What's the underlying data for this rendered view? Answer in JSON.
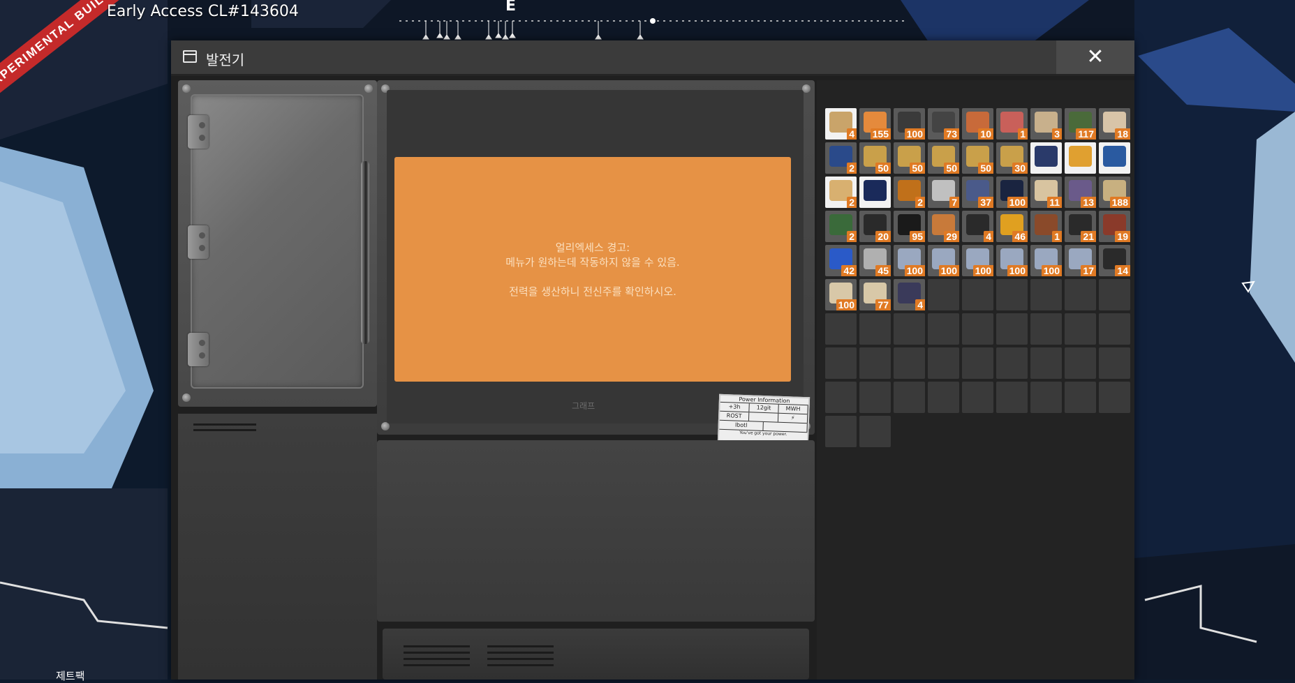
{
  "hud": {
    "build_label": "Early Access CL#143604",
    "banner": "EXPERIMENTAL BUILD",
    "compass_heading": "E",
    "jetpack_label": "제트팩"
  },
  "window": {
    "title": "발전기",
    "close_glyph": "✕"
  },
  "warning": {
    "line1": "얼리엑세스 경고:",
    "line2": "메뉴가 원하는데 작동하지 않을 수 있음.",
    "line3": "전력을 생산하니 전신주를 확인하시오."
  },
  "graph_label": "그래프",
  "power_card": {
    "title": "Power Information",
    "row1": [
      "+3h",
      "12git",
      "MWH"
    ],
    "row2": [
      "ROST",
      "",
      ""
    ],
    "row3": [
      "lbotl",
      "",
      ""
    ],
    "footer": "You've got your power."
  },
  "inventory": {
    "columns": 9,
    "total_slots": 83,
    "items": [
      {
        "qty": "4",
        "icon": "cable-icon",
        "color": "#c9a46a",
        "highlight": true
      },
      {
        "qty": "155",
        "icon": "ingot-icon",
        "color": "#e58a3c",
        "highlight": false
      },
      {
        "qty": "100",
        "icon": "rod-bundle-icon",
        "color": "#3a3a3a",
        "highlight": false
      },
      {
        "qty": "73",
        "icon": "rod-bundle-icon",
        "color": "#444444",
        "highlight": false
      },
      {
        "qty": "10",
        "icon": "beacon-icon",
        "color": "#c86a3a",
        "highlight": false
      },
      {
        "qty": "1",
        "icon": "crystal-icon",
        "color": "#c9605a",
        "highlight": false
      },
      {
        "qty": "3",
        "icon": "plank-icon",
        "color": "#c8b08c",
        "highlight": false
      },
      {
        "qty": "117",
        "icon": "leaves-icon",
        "color": "#4a6a3a",
        "highlight": false
      },
      {
        "qty": "18",
        "icon": "biomass-icon",
        "color": "#d8c4a8",
        "highlight": false
      },
      {
        "qty": "2",
        "icon": "motor-icon",
        "color": "#2a4a8a",
        "highlight": false
      },
      {
        "qty": "50",
        "icon": "wire-coil-icon",
        "color": "#c9a04a",
        "highlight": false
      },
      {
        "qty": "50",
        "icon": "wire-coil-icon",
        "color": "#c9a04a",
        "highlight": false
      },
      {
        "qty": "50",
        "icon": "wire-coil-icon",
        "color": "#c9a04a",
        "highlight": false
      },
      {
        "qty": "50",
        "icon": "wire-coil-icon",
        "color": "#c9a04a",
        "highlight": false
      },
      {
        "qty": "30",
        "icon": "wire-coil-icon",
        "color": "#c9a04a",
        "highlight": false
      },
      {
        "qty": "",
        "icon": "chainsaw-icon",
        "color": "#2a3a6a",
        "highlight": true
      },
      {
        "qty": "",
        "icon": "object-scanner-icon",
        "color": "#e0a030",
        "highlight": true
      },
      {
        "qty": "",
        "icon": "coffee-cup-icon",
        "color": "#2a5aa0",
        "highlight": true
      },
      {
        "qty": "2",
        "icon": "spiked-rebar-icon",
        "color": "#d8b070",
        "highlight": true
      },
      {
        "qty": "",
        "icon": "xeno-zapper-icon",
        "color": "#1a2a5a",
        "highlight": true
      },
      {
        "qty": "2",
        "icon": "frame-icon",
        "color": "#c0701a",
        "highlight": false
      },
      {
        "qty": "7",
        "icon": "hook-icon",
        "color": "#c0c0c0",
        "highlight": false
      },
      {
        "qty": "37",
        "icon": "modular-frame-icon",
        "color": "#4a5a8a",
        "highlight": false
      },
      {
        "qty": "100",
        "icon": "coal-icon",
        "color": "#1a2440",
        "highlight": false
      },
      {
        "qty": "11",
        "icon": "limestone-icon",
        "color": "#d8c4a0",
        "highlight": false
      },
      {
        "qty": "13",
        "icon": "ore-icon",
        "color": "#6a5a8a",
        "highlight": false
      },
      {
        "qty": "188",
        "icon": "spool-icon",
        "color": "#c8b080",
        "highlight": false
      },
      {
        "qty": "2",
        "icon": "circuit-board-icon",
        "color": "#3a6a3a",
        "highlight": false
      },
      {
        "qty": "20",
        "icon": "computer-icon",
        "color": "#2a2a2a",
        "highlight": false
      },
      {
        "qty": "95",
        "icon": "battery-icon",
        "color": "#1a1a1a",
        "highlight": false
      },
      {
        "qty": "29",
        "icon": "copper-coil-icon",
        "color": "#c87a3a",
        "highlight": false
      },
      {
        "qty": "4",
        "icon": "rubber-ring-icon",
        "color": "#2a2a2a",
        "highlight": false
      },
      {
        "qty": "46",
        "icon": "rotor-icon",
        "color": "#e0a020",
        "highlight": false
      },
      {
        "qty": "1",
        "icon": "pipe-icon",
        "color": "#8a4a2a",
        "highlight": false
      },
      {
        "qty": "21",
        "icon": "rod-bundle-icon",
        "color": "#2a2a2a",
        "highlight": false
      },
      {
        "qty": "19",
        "icon": "cylinder-icon",
        "color": "#8a3a2a",
        "highlight": false
      },
      {
        "qty": "42",
        "icon": "container-icon",
        "color": "#2a5ac8",
        "highlight": false
      },
      {
        "qty": "45",
        "icon": "cube-frame-icon",
        "color": "#b0b0b0",
        "highlight": false
      },
      {
        "qty": "100",
        "icon": "plate-icon",
        "color": "#9aa8c0",
        "highlight": false
      },
      {
        "qty": "100",
        "icon": "plate-icon",
        "color": "#9aa8c0",
        "highlight": false
      },
      {
        "qty": "100",
        "icon": "plate-icon",
        "color": "#9aa8c0",
        "highlight": false
      },
      {
        "qty": "100",
        "icon": "plate-icon",
        "color": "#9aa8c0",
        "highlight": false
      },
      {
        "qty": "100",
        "icon": "plate-icon",
        "color": "#9aa8c0",
        "highlight": false
      },
      {
        "qty": "17",
        "icon": "plate-icon",
        "color": "#9aa8c0",
        "highlight": false
      },
      {
        "qty": "14",
        "icon": "rod-bundle-icon",
        "color": "#2a2a2a",
        "highlight": false
      },
      {
        "qty": "100",
        "icon": "concrete-icon",
        "color": "#d8c8a8",
        "highlight": false
      },
      {
        "qty": "77",
        "icon": "concrete-icon",
        "color": "#d8c8a8",
        "highlight": false
      },
      {
        "qty": "4",
        "icon": "rod-bundle-icon",
        "color": "#3a3a5a",
        "highlight": false
      }
    ]
  }
}
